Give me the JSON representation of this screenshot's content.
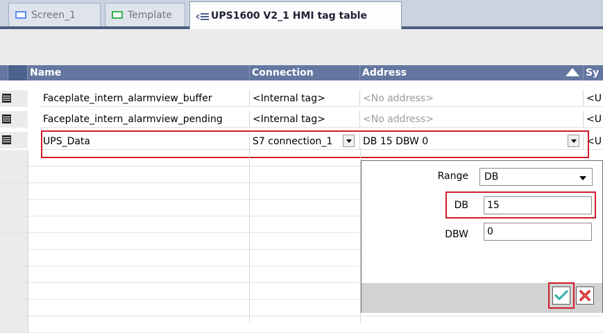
{
  "tabs": [
    {
      "label": "Screen_1",
      "icon": "screen-icon",
      "active": false
    },
    {
      "label": "Template",
      "icon": "template-icon",
      "active": false
    },
    {
      "label": "UPS1600 V2_1 HMI tag table",
      "icon": "tag-table-icon",
      "active": true
    }
  ],
  "table": {
    "columns": [
      "Name",
      "Connection",
      "Address",
      "Sy"
    ],
    "rows": [
      {
        "name": "Faceplate_intern_alarmview_buffer",
        "connection": "<Internal tag>",
        "address": "<No address>",
        "extra": "<U"
      },
      {
        "name": "Faceplate_intern_alarmview_pending",
        "connection": "<Internal tag>",
        "address": "<No address>",
        "extra": "<U"
      },
      {
        "name": "UPS_Data",
        "connection": "S7 connection_1",
        "address": "DB 15 DBW 0",
        "extra": "<U"
      }
    ]
  },
  "popup": {
    "range_label": "Range",
    "range_value": "DB",
    "db_label": "DB",
    "db_value": "15",
    "dbw_label": "DBW",
    "dbw_value": "0"
  },
  "colors": {
    "header_bg": "#6377a0",
    "highlight": "#d11b2a",
    "tab_rule": "#4d5d7e"
  }
}
